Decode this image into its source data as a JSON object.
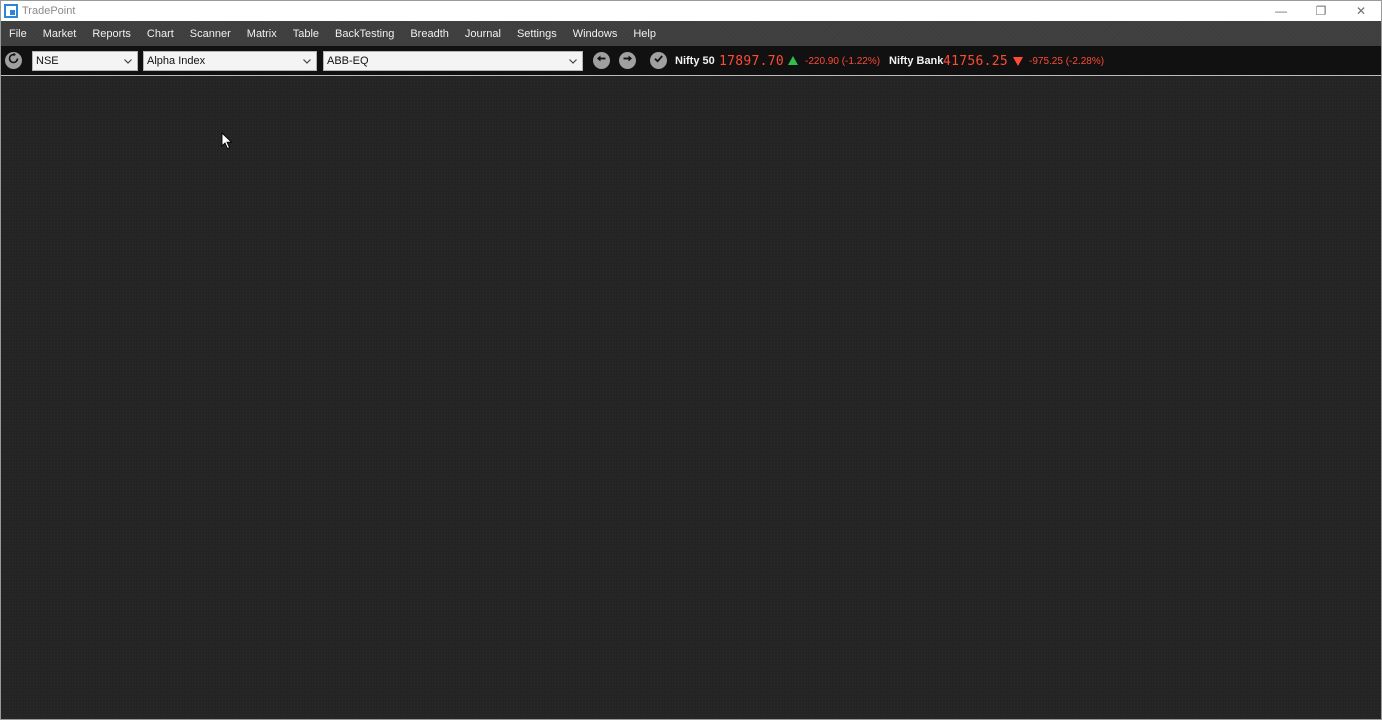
{
  "window": {
    "title": "TradePoint",
    "controls": [
      "—",
      "❐",
      "✕"
    ]
  },
  "menu": [
    "File",
    "Market",
    "Reports",
    "Chart",
    "Scanner",
    "Matrix",
    "Table",
    "BackTesting",
    "Breadth",
    "Journal",
    "Settings",
    "Windows",
    "Help"
  ],
  "toolbar": {
    "exchange": "NSE",
    "sort": "Alpha Index",
    "symbol": "ABB-EQ",
    "icons": {
      "refresh": "refresh-icon",
      "back": "arrow-left-icon",
      "forward": "arrow-right-icon",
      "confirm": "check-icon"
    }
  },
  "indices": [
    {
      "name": "Nifty 50",
      "value": "17897.70",
      "change": "-220.90 (-1.22%)",
      "direction": "up"
    },
    {
      "name": "Nifty Bank",
      "value": "41756.25",
      "change": "-975.25 (-2.28%)",
      "direction": "down"
    }
  ],
  "colors": {
    "negative": "#ff4a35",
    "up_arrow": "#2fbf4a",
    "menu_bg": "#3e3e3e",
    "toolbar_bg": "#111111",
    "workspace_bg": "#242424"
  }
}
